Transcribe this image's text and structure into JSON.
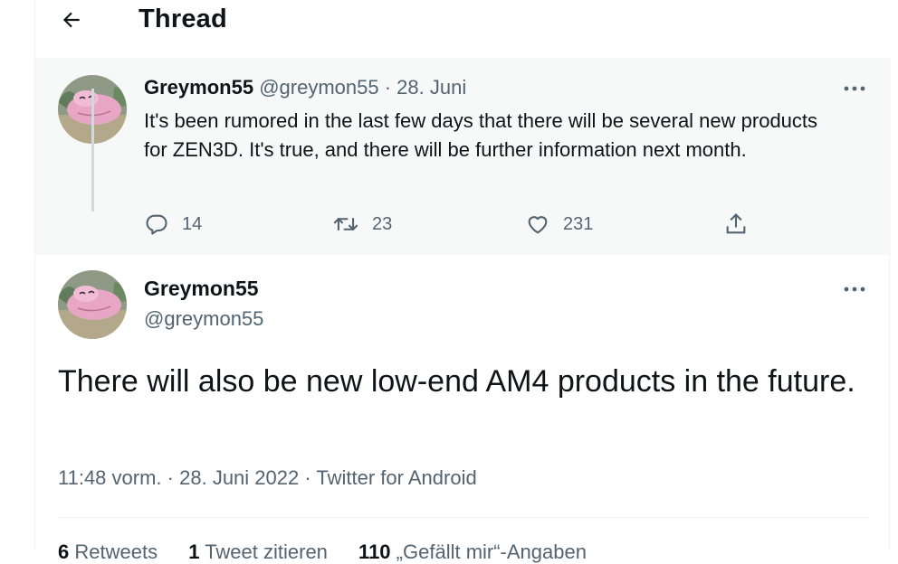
{
  "header": {
    "title": "Thread"
  },
  "parent_tweet": {
    "name": "Greymon55",
    "handle": "@greymon55",
    "separator": "·",
    "date": "28. Juni",
    "text": "It's been rumored in the last few days that there will be several new products for ZEN3D. It's true, and there will be further information next month.",
    "replies": "14",
    "retweets": "23",
    "likes": "231"
  },
  "main_tweet": {
    "name": "Greymon55",
    "handle": "@greymon55",
    "text": "There will also be new low-end AM4 products in the future.",
    "time": "11:48 vorm.",
    "separator": "·",
    "date": "28. Juni 2022",
    "separator2": "·",
    "source": "Twitter for Android",
    "stats": {
      "retweets_count": "6",
      "retweets_label": "Retweets",
      "quotes_count": "1",
      "quotes_label": "Tweet zitieren",
      "likes_count": "110",
      "likes_label": "„Gefällt mir“-Angaben"
    }
  },
  "colors": {
    "text_primary": "#0f1419",
    "text_secondary": "#536471",
    "parent_background": "#f7f9f9",
    "thread_line": "#cfd9de"
  },
  "icons": [
    "back-arrow-icon",
    "more-icon",
    "reply-icon",
    "retweet-icon",
    "like-icon",
    "share-icon"
  ]
}
